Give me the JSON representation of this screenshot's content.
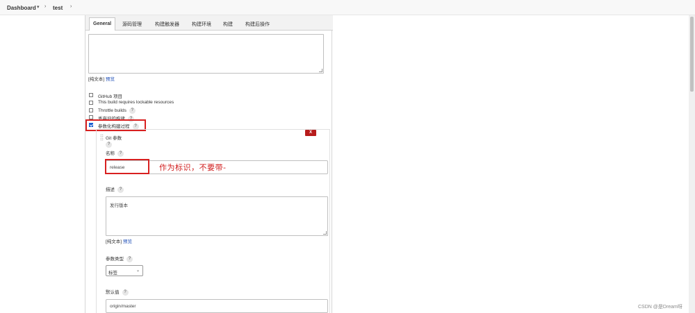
{
  "breadcrumb": {
    "dashboard": "Dashboard",
    "job": "test"
  },
  "tabs": [
    "General",
    "源码管理",
    "构建触发器",
    "构建环境",
    "构建",
    "构建后操作"
  ],
  "description_editor": {
    "plain_text": "[纯文本]",
    "preview": "预览"
  },
  "options": [
    {
      "label": "GitHub 项目",
      "checked": false
    },
    {
      "label": "This build requires lockable resources",
      "checked": false
    },
    {
      "label": "Throttle builds",
      "checked": false,
      "help": "?"
    },
    {
      "label": "丢弃旧的构建",
      "checked": false,
      "help": "?"
    },
    {
      "label": "参数化构建过程",
      "checked": true,
      "help": "?"
    }
  ],
  "parameter": {
    "delete_label": "X",
    "type_title": "Git 参数",
    "help": "?",
    "name_label": "名称",
    "name_value": "release",
    "description_label": "描述",
    "description_value": "发行版本",
    "desc_plain_text": "[纯文本]",
    "desc_preview": "预览",
    "param_type_label": "参数类型",
    "param_type_value": "标签",
    "default_label": "默认值",
    "default_value": "origin/master"
  },
  "annotation": "作为标识，不要带-",
  "watermark": "CSDN @是Dream呀"
}
